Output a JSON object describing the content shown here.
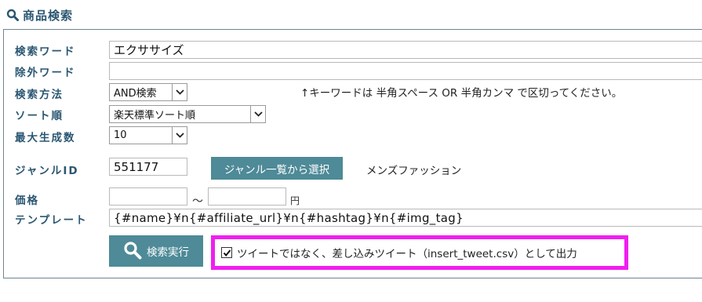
{
  "header": {
    "title": "商品検索",
    "icon": "search-icon"
  },
  "form": {
    "keyword": {
      "label": "検索ワード",
      "value": "エクササイズ"
    },
    "exclude": {
      "label": "除外ワード",
      "value": ""
    },
    "method": {
      "label": "検索方法",
      "selected": "AND検索"
    },
    "note": "↑キーワードは 半角スペース OR 半角カンマ で区切ってください。",
    "sort": {
      "label": "ソート順",
      "selected": "楽天標準ソート順"
    },
    "max_count": {
      "label": "最大生成数",
      "selected": "10"
    },
    "genre": {
      "label": "ジャンルID",
      "value": "551177",
      "button_label": "ジャンル一覧から選択",
      "genre_name": "メンズファッション"
    },
    "price": {
      "label": "価格",
      "min": "",
      "max": "",
      "separator": "～",
      "unit": "円"
    },
    "template": {
      "label": "テンプレート",
      "value": "{#name}¥n{#affiliate_url}¥n{#hashtag}¥n{#img_tag}"
    },
    "search_button": {
      "label": "検索実行"
    },
    "tweet_option": {
      "label": "ツイートではなく、差し込みツイート（insert_tweet.csv）として出力",
      "checked": true
    }
  },
  "colors": {
    "accent": "#4e8a97",
    "label": "#2a5672",
    "highlight": "#f01ef0",
    "border": "#6f8592"
  }
}
